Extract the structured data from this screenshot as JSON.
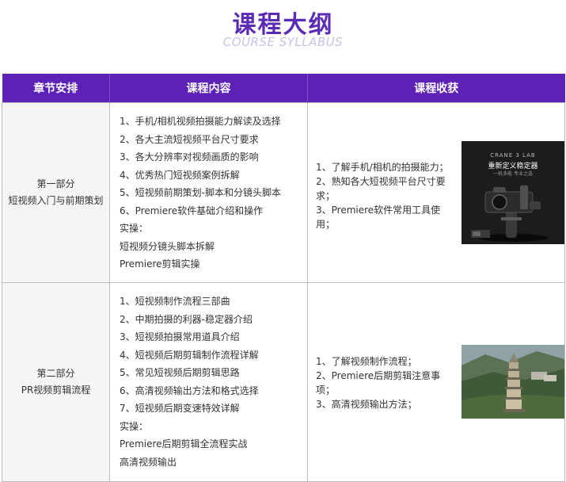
{
  "header": {
    "title": "课程大纲",
    "subtitle": "COURSE SYLLABUS"
  },
  "table": {
    "headers": [
      "章节安排",
      "课程内容",
      "课程收获"
    ],
    "rows": [
      {
        "section_line1": "第一部分",
        "section_line2": "短视频入门与前期策划",
        "content": [
          "1、手机/相机视频拍摄能力解读及选择",
          "2、各大主流短视频平台尺寸要求",
          "3、各大分辨率对视频画质的影响",
          "4、优秀热门短视频案例拆解",
          "5、短视频前期策划-脚本和分镜头脚本",
          "6、Premiere软件基础介绍和操作",
          "实操：",
          "短视频分镜头脚本拆解",
          "Premiere剪辑实操"
        ],
        "harvest": [
          "1、了解手机/相机的拍摄能力；",
          "2、熟知各大短视频平台尺寸要",
          "求；",
          "3、Premiere软件常用工具使",
          "用；"
        ],
        "image_text": {
          "line1": "CRANE 3 LAB",
          "line2": "重新定义稳定器",
          "line3": "一机多能 专业之选"
        }
      },
      {
        "section_line1": "第二部分",
        "section_line2": "PR视频剪辑流程",
        "content": [
          "1、短视频制作流程三部曲",
          "2、中期拍摄的利器-稳定器介绍",
          "3、短视频拍摄常用道具介绍",
          "4、短视频后期剪辑制作流程详解",
          "5、常见短视频后期剪辑思路",
          "6、高清视频输出方法和格式选择",
          "7、短视频后期变速特效详解",
          "实操：",
          "Premiere后期剪辑全流程实战",
          "高清视频输出"
        ],
        "harvest": [
          "1、了解视频制作流程；",
          "2、Premiere后期剪辑注意事",
          "项；",
          "3、高清视频输出方法；"
        ]
      }
    ]
  },
  "colors": {
    "title": "#5b2bb5",
    "subtitle": "#c9c2e6",
    "header_bg": "#5d21b8"
  }
}
